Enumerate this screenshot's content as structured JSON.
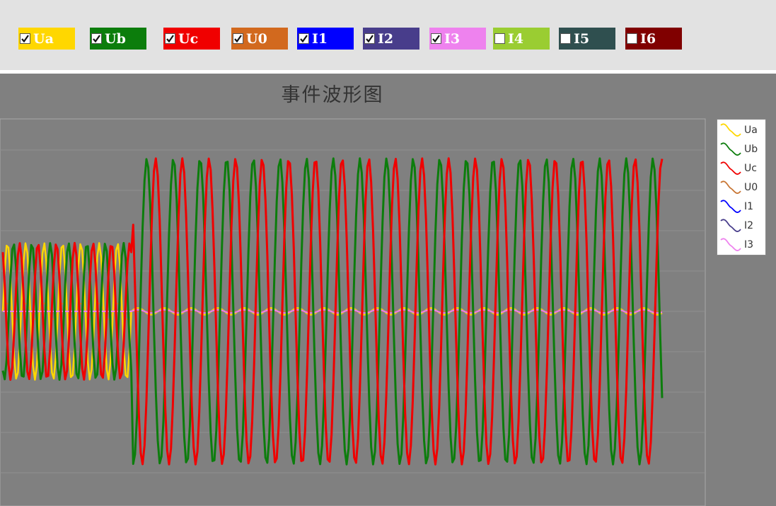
{
  "toolbar": {
    "channels": [
      {
        "name": "Ua",
        "checked": true,
        "color": "#ffd700"
      },
      {
        "name": "Ub",
        "checked": true,
        "color": "#0c7d0c"
      },
      {
        "name": "Uc",
        "checked": true,
        "color": "#f00000"
      },
      {
        "name": "U0",
        "checked": true,
        "color": "#d2691e"
      },
      {
        "name": "I1",
        "checked": true,
        "color": "#0000ff"
      },
      {
        "name": "I2",
        "checked": true,
        "color": "#483d8b"
      },
      {
        "name": "I3",
        "checked": true,
        "color": "#ee82ee"
      },
      {
        "name": "I4",
        "checked": false,
        "color": "#9acd32"
      },
      {
        "name": "I5",
        "checked": false,
        "color": "#2f4f4f"
      },
      {
        "name": "I6",
        "checked": false,
        "color": "#800000"
      }
    ]
  },
  "chart_data": {
    "type": "line",
    "title": "事件波形图",
    "xlabel": "",
    "ylabel": "",
    "grid": true,
    "legend_position": "right",
    "legend": [
      "Ua",
      "Ub",
      "Uc",
      "U0",
      "I1",
      "I2",
      "I3"
    ],
    "samples": 350,
    "event_sample": 68,
    "cycles_pre_event": 7,
    "cycles_post_event": 20,
    "ylim": [
      -1.3,
      1.3
    ],
    "series": [
      {
        "name": "Ua",
        "color": "#ffd700",
        "phase_deg": 0,
        "amplitude_pre": 0.42,
        "amplitude_post": 0.02
      },
      {
        "name": "Ub",
        "color": "#0c7d0c",
        "phase_deg": -120,
        "amplitude_pre": 0.42,
        "amplitude_post": 0.94
      },
      {
        "name": "Uc",
        "color": "#f00000",
        "phase_deg": 120,
        "amplitude_pre": 0.42,
        "amplitude_post": 0.94
      },
      {
        "name": "U0",
        "color": "#c87533",
        "phase_deg": 0,
        "amplitude_pre": 0.05,
        "amplitude_post": 0.0
      },
      {
        "name": "I1",
        "color": "#0000ff",
        "phase_deg": 0,
        "amplitude_pre": 0.0,
        "amplitude_post": 0.01
      },
      {
        "name": "I2",
        "color": "#483d8b",
        "phase_deg": 0,
        "amplitude_pre": 0.0,
        "amplitude_post": 0.01
      },
      {
        "name": "I3",
        "color": "#ee82ee",
        "phase_deg": 0,
        "amplitude_pre": 0.0,
        "amplitude_post": 0.01
      }
    ]
  }
}
